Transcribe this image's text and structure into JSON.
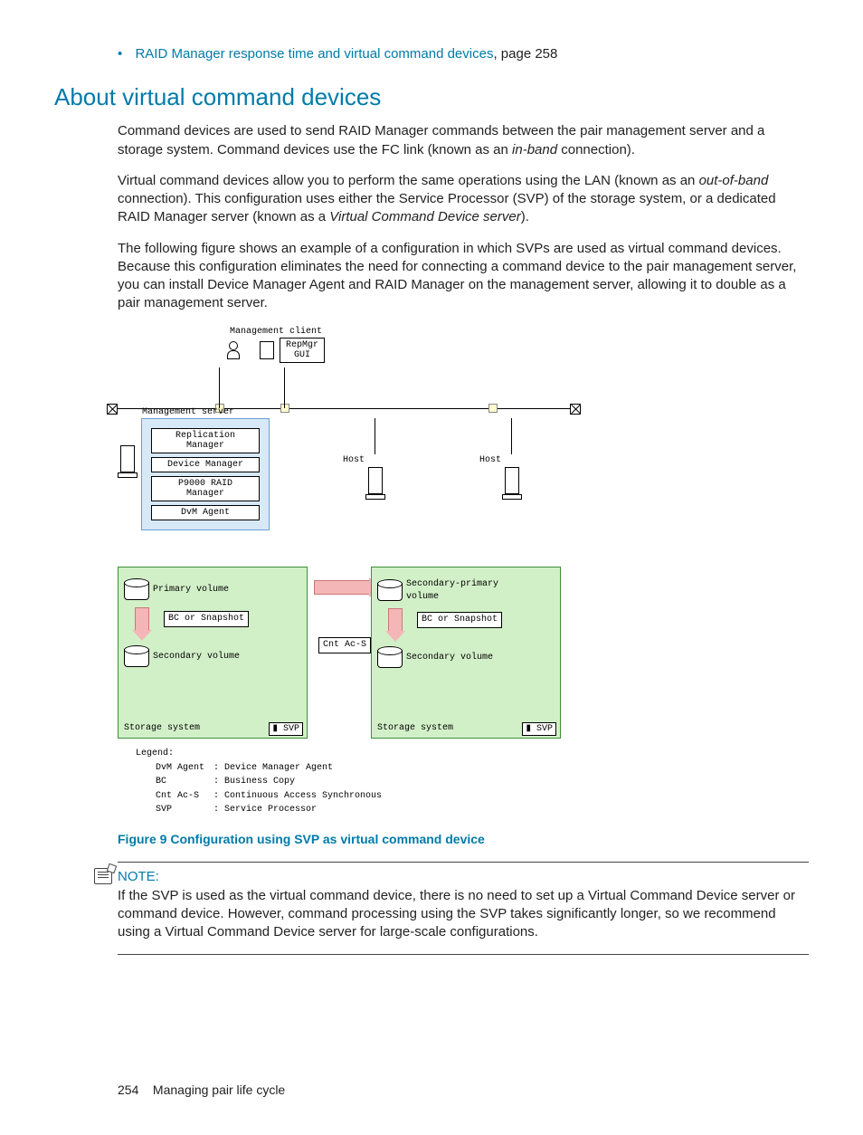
{
  "bullet": {
    "link_text": "RAID Manager response time and virtual command devices",
    "page_ref": ", page 258"
  },
  "heading": "About virtual command devices",
  "para1_a": "Command devices are used to send RAID Manager commands between the pair management server and a storage system. Command devices use the FC link (known as an ",
  "para1_i": "in-band",
  "para1_b": " connection).",
  "para2_a": "Virtual command devices allow you to perform the same operations using the LAN (known as an ",
  "para2_i": "out-of-band",
  "para2_b": " connection). This configuration uses either the Service Processor (SVP) of the storage system, or a dedicated RAID Manager server (known as a ",
  "para2_i2": "Virtual Command Device server",
  "para2_c": ").",
  "para3": "The following figure shows an example of a configuration in which SVPs are used as virtual command devices. Because this configuration eliminates the need for connecting a command device to the pair management server, you can install Device Manager Agent and RAID Manager on the management server, allowing it to double as a pair management server.",
  "diagram": {
    "mgmt_client": "Management client",
    "repmgr_gui": "RepMgr\nGUI",
    "mgmt_server": "Management server",
    "boxes": {
      "replication_manager": "Replication\nManager",
      "device_manager": "Device Manager",
      "p9000_raid": "P9000 RAID\nManager",
      "dvm_agent": "DvM Agent"
    },
    "host": "Host",
    "storage_system": "Storage system",
    "primary_volume": "Primary volume",
    "secondary_primary": "Secondary-primary\nvolume",
    "bc_snapshot": "BC or Snapshot",
    "cnt_ac_s": "Cnt Ac-S",
    "secondary_volume": "Secondary volume",
    "svp": "SVP",
    "legend_title": "Legend:",
    "legend": [
      {
        "k": "DvM Agent",
        "v": ": Device Manager Agent"
      },
      {
        "k": "BC",
        "v": ": Business Copy"
      },
      {
        "k": "Cnt Ac-S",
        "v": ": Continuous Access Synchronous"
      },
      {
        "k": "SVP",
        "v": ": Service Processor"
      }
    ]
  },
  "figure_caption": "Figure 9 Configuration using SVP as virtual command device",
  "note_label": "NOTE:",
  "note_text": "If the SVP is used as the virtual command device, there is no need to set up a Virtual Command Device server or command device. However, command processing using the SVP takes significantly longer, so we recommend using a Virtual Command Device server for large-scale configurations.",
  "footer_page": "254",
  "footer_text": "Managing pair life cycle"
}
